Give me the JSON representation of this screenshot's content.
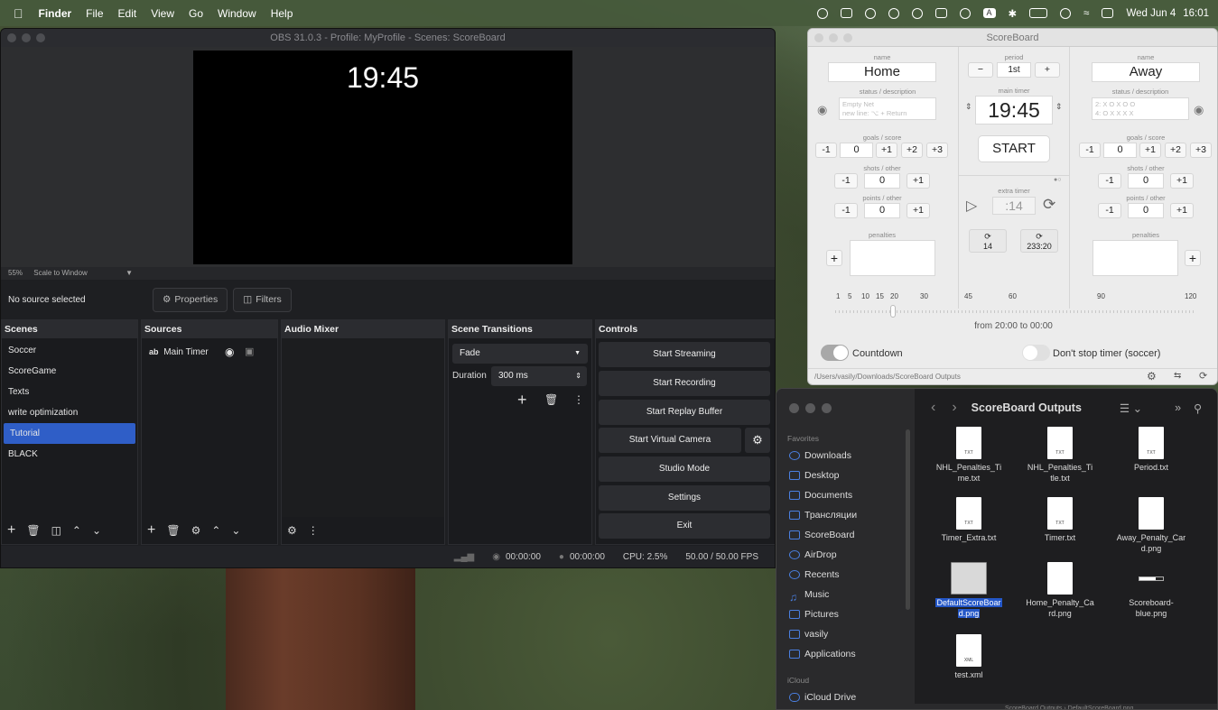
{
  "menubar": {
    "app": "Finder",
    "items": [
      "File",
      "Edit",
      "View",
      "Go",
      "Window",
      "Help"
    ],
    "clock_date": "Wed Jun 4",
    "clock_time": "16:01"
  },
  "obs": {
    "title": "OBS 31.0.3 - Profile: MyProfile - Scenes: ScoreBoard",
    "preview_time": "19:45",
    "zoom": "55%",
    "scale_mode": "Scale to Window",
    "no_source": "No source selected",
    "properties_label": "Properties",
    "filters_label": "Filters",
    "docks": {
      "scenes": "Scenes",
      "sources": "Sources",
      "audio_mixer": "Audio Mixer",
      "transitions": "Scene Transitions",
      "controls": "Controls"
    },
    "scenes": [
      "Soccer",
      "ScoreGame",
      "Texts",
      "write optimization",
      "Tutorial",
      "BLACK"
    ],
    "selected_scene": "Tutorial",
    "sources": [
      {
        "icon": "ab",
        "name": "Main Timer"
      }
    ],
    "transition": "Fade",
    "duration_label": "Duration",
    "duration_value": "300 ms",
    "controls": [
      "Start Streaming",
      "Start Recording",
      "Start Replay Buffer",
      "Start Virtual Camera",
      "Studio Mode",
      "Settings",
      "Exit"
    ],
    "status": {
      "rec_time": "00:00:00",
      "stream_time": "00:00:00",
      "cpu": "CPU: 2.5%",
      "fps": "50.00 / 50.00 FPS"
    }
  },
  "scoreboard": {
    "title": "ScoreBoard",
    "name_label": "name",
    "period_label": "period",
    "period_value": "1st",
    "home_name": "Home",
    "away_name": "Away",
    "status_label": "status / description",
    "home_status_placeholder_1": "Empty Net",
    "home_status_placeholder_2": "new line: ⌥ + Return",
    "away_status_placeholder_1": "2: X O X O O",
    "away_status_placeholder_2": "4: O X X X X",
    "main_timer_label": "main timer",
    "main_timer": "19:45",
    "start_label": "START",
    "goals_label": "goals / score",
    "shots_label": "shots / other",
    "points_label": "points / other",
    "penalties_label": "penalties",
    "home_goals": "0",
    "home_shots": "0",
    "home_points": "0",
    "away_goals": "0",
    "away_shots": "0",
    "away_points": "0",
    "minus1": "-1",
    "plus1": "+1",
    "plus2": "+2",
    "plus3": "+3",
    "extra_timer_label": "extra timer",
    "extra_timer": ":14",
    "sub_timer_1": "14",
    "sub_timer_2": "233:20",
    "ticks": [
      "1",
      "5",
      "10",
      "15",
      "20",
      "30",
      "45",
      "60",
      "90",
      "120"
    ],
    "range_text": "from 20:00 to 00:00",
    "countdown_label": "Countdown",
    "dont_stop_label": "Don't stop timer (soccer)",
    "path": "/Users/vasily/Downloads/ScoreBoard Outputs"
  },
  "finder": {
    "title": "ScoreBoard Outputs",
    "favorites_label": "Favorites",
    "favorites": [
      "Downloads",
      "Desktop",
      "Documents",
      "Трансляции",
      "ScoreBoard",
      "AirDrop",
      "Recents",
      "Music",
      "Pictures",
      "vasily",
      "Applications"
    ],
    "icloud_label": "iCloud",
    "icloud": [
      "iCloud Drive"
    ],
    "files": [
      {
        "name1": "NHL_Penalties_Ti",
        "name2": "me.txt",
        "type": "TXT"
      },
      {
        "name1": "NHL_Penalties_Ti",
        "name2": "tle.txt",
        "type": "TXT"
      },
      {
        "name1": "Period.txt",
        "name2": "",
        "type": "TXT"
      },
      {
        "name1": "Timer_Extra.txt",
        "name2": "",
        "type": "TXT"
      },
      {
        "name1": "Timer.txt",
        "name2": "",
        "type": "TXT"
      },
      {
        "name1": "Away_Penalty_Car",
        "name2": "d.png",
        "type": ""
      },
      {
        "name1": "DefaultScoreBoar",
        "name2": "d.png",
        "type": ""
      },
      {
        "name1": "Home_Penalty_Ca",
        "name2": "rd.png",
        "type": ""
      },
      {
        "name1": "Scoreboard-",
        "name2": "blue.png",
        "type": ""
      },
      {
        "name1": "test.xml",
        "name2": "",
        "type": "XML"
      }
    ],
    "path_bar": "ScoreBoard Outputs  ›  DefaultScoreBoard.png"
  }
}
